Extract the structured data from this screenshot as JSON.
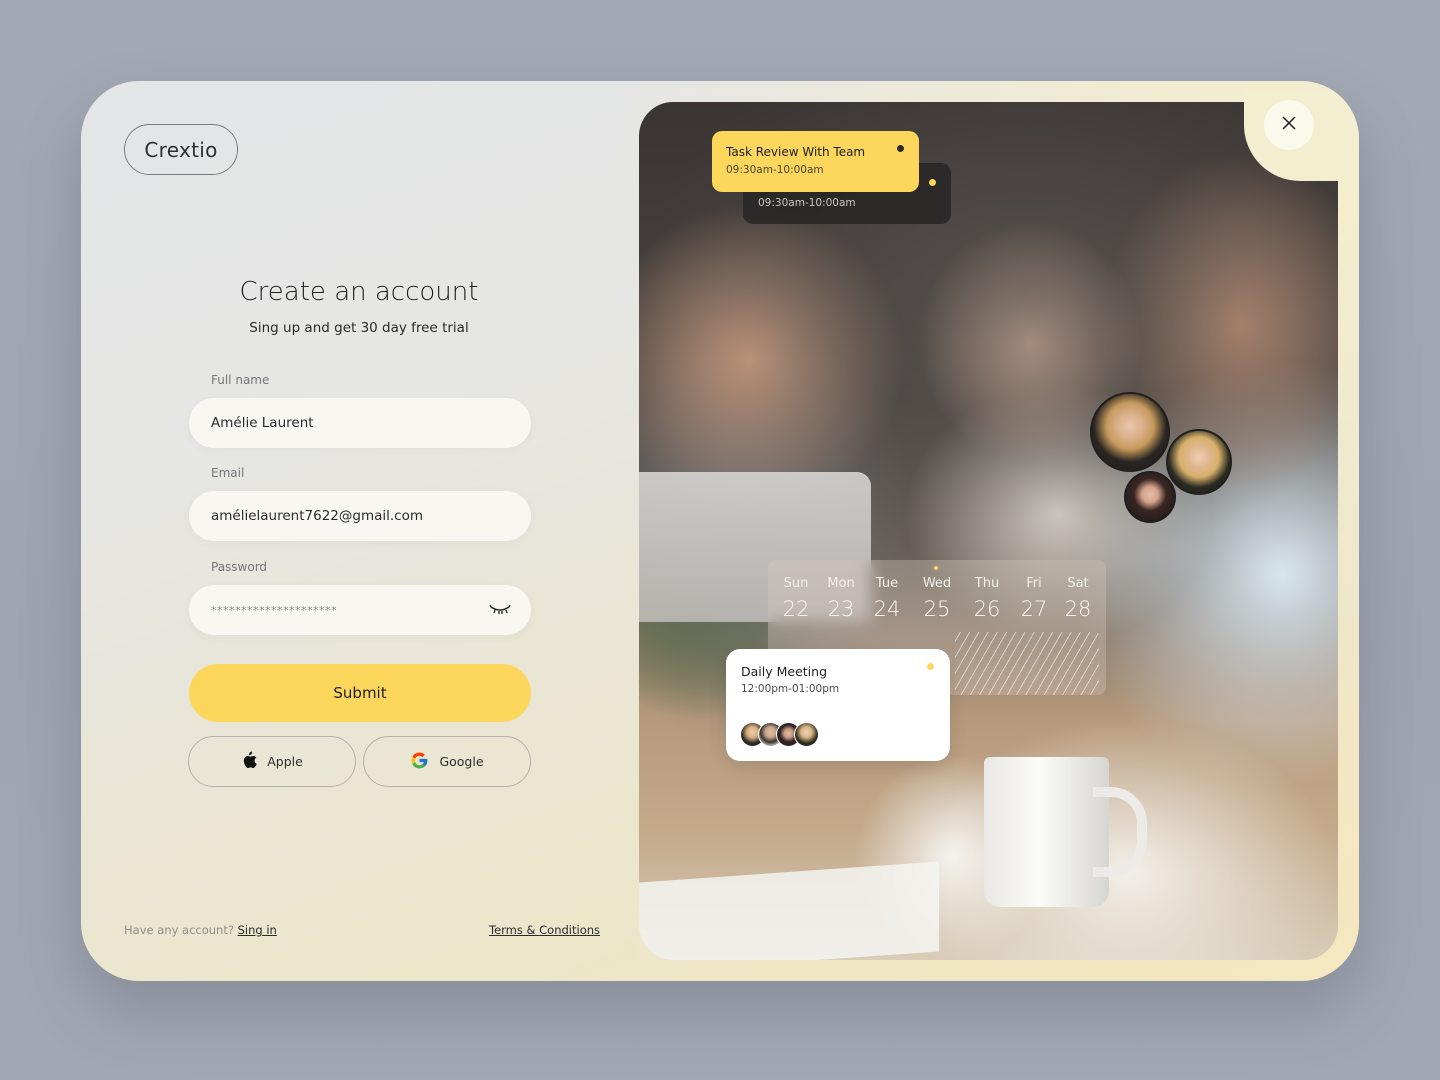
{
  "brand": {
    "logo_text": "Crextio"
  },
  "form": {
    "title": "Create an account",
    "subtitle": "Sing up and get 30 day free trial",
    "full_name": {
      "label": "Full name",
      "value": "Amélie Laurent"
    },
    "email": {
      "label": "Email",
      "value": "amélielaurent7622@gmail.com"
    },
    "password": {
      "label": "Password",
      "value": "*********************",
      "toggle_icon": "eye-closed-icon"
    },
    "submit_label": "Submit",
    "social": {
      "apple_label": "Apple",
      "google_label": "Google"
    }
  },
  "footer": {
    "have_account_text": "Have any account?",
    "sign_in_link": "Sing in",
    "terms_link": "Terms & Conditions"
  },
  "preview": {
    "close_icon": "close-icon",
    "task_front": {
      "title": "Task Review With Team",
      "time": "09:30am-10:00am"
    },
    "task_back": {
      "time": "09:30am-10:00am"
    },
    "calendar": {
      "days": [
        {
          "day": "Sun",
          "date": "22"
        },
        {
          "day": "Mon",
          "date": "23"
        },
        {
          "day": "Tue",
          "date": "24"
        },
        {
          "day": "Wed",
          "date": "25"
        },
        {
          "day": "Thu",
          "date": "26"
        },
        {
          "day": "Fri",
          "date": "27"
        },
        {
          "day": "Sat",
          "date": "28"
        }
      ],
      "highlighted_day": "Wed"
    },
    "meeting": {
      "title": "Daily Meeting",
      "time": "12:00pm-01:00pm",
      "participant_count": 4
    },
    "team_avatar_count": 3
  },
  "colors": {
    "accent": "#fdd65c",
    "text_dark": "#1f2022",
    "muted": "#76777a"
  }
}
